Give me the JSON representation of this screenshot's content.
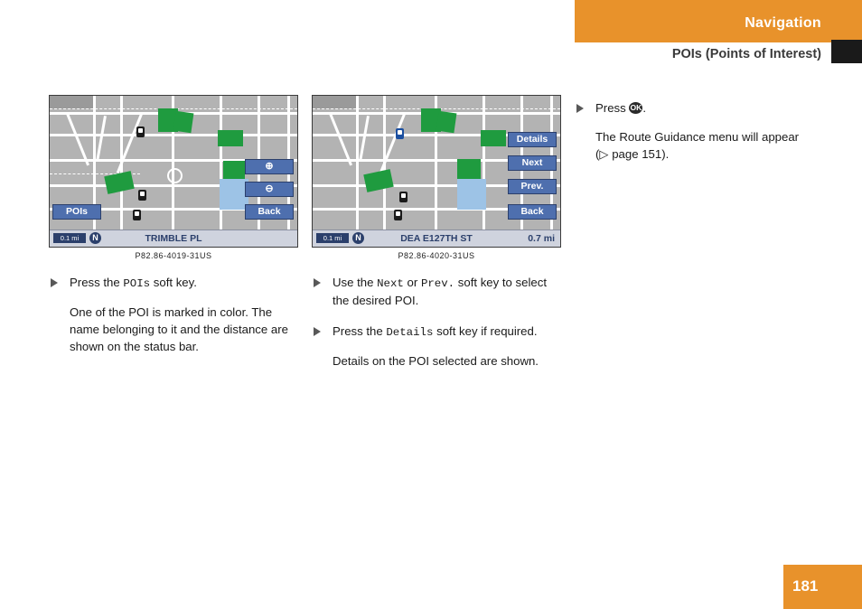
{
  "header": {
    "title": "Navigation",
    "subtitle": "POIs (Points of Interest)",
    "accent_color": "#e8922b"
  },
  "page_number": "181",
  "columns": [
    {
      "screen": {
        "softkeys": [
          "POIs",
          "Back"
        ],
        "zoom_in_icon": "zoom-in-icon",
        "zoom_out_icon": "zoom-out-icon",
        "status": {
          "scale": "0.1 mi",
          "compass": "N",
          "center_text": "TRIMBLE PL",
          "right_text": ""
        }
      },
      "caption": "P82.86-4019-31US",
      "steps": [
        {
          "bullet": "▶",
          "text_before": "Press the ",
          "mono": "POIs",
          "text_after": " soft key."
        }
      ],
      "paragraphs": [
        "One of the POI is marked in color. The name belonging to it and the distance are shown on the status bar."
      ]
    },
    {
      "screen": {
        "softkeys": [
          "Details",
          "Next",
          "Prev.",
          "Back"
        ],
        "status": {
          "scale": "0.1 mi",
          "compass": "N",
          "center_text": "DEA  E127TH ST",
          "right_text": "0.7 mi"
        }
      },
      "caption": "P82.86-4020-31US",
      "steps": [
        {
          "bullet": "▶",
          "text_before": "Use the ",
          "mono": "Next",
          "text_mid": " or ",
          "mono2": "Prev.",
          "text_after": " soft key to select the desired POI."
        },
        {
          "bullet": "▶",
          "text_before": "Press the ",
          "mono": "Details",
          "text_after": " soft key if required."
        }
      ],
      "paragraphs": [
        "Details on the POI selected are shown."
      ]
    },
    {
      "steps": [
        {
          "bullet": "▶",
          "text_before": "Press ",
          "key_label": "OK",
          "text_after": "."
        }
      ],
      "paragraphs": [
        "The Route Guidance menu will appear",
        "(▷ page 151)."
      ]
    }
  ]
}
